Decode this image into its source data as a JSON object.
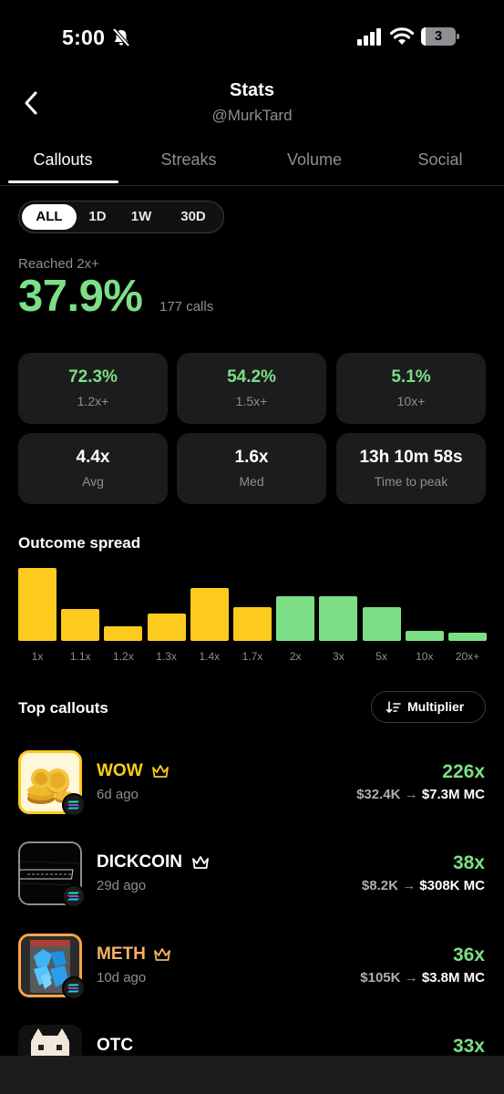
{
  "status_bar": {
    "time": "5:00",
    "battery": "3"
  },
  "header": {
    "title": "Stats",
    "subtitle": "@MurkTard"
  },
  "tabs": [
    {
      "label": "Callouts",
      "active": true
    },
    {
      "label": "Streaks",
      "active": false
    },
    {
      "label": "Volume",
      "active": false
    },
    {
      "label": "Social",
      "active": false
    }
  ],
  "range_filter": {
    "options": [
      "ALL",
      "1D",
      "1W",
      "30D"
    ],
    "selected": "ALL"
  },
  "reached": {
    "label": "Reached 2x+",
    "value": "37.9%",
    "calls": "177 calls"
  },
  "stat_cards": [
    {
      "value": "72.3%",
      "label": "1.2x+",
      "highlight": true
    },
    {
      "value": "54.2%",
      "label": "1.5x+",
      "highlight": true
    },
    {
      "value": "5.1%",
      "label": "10x+",
      "highlight": true
    },
    {
      "value": "4.4x",
      "label": "Avg",
      "highlight": false
    },
    {
      "value": "1.6x",
      "label": "Med",
      "highlight": false
    },
    {
      "value": "13h 10m 58s",
      "label": "Time to peak",
      "highlight": false
    }
  ],
  "outcome_title": "Outcome spread",
  "chart_data": {
    "type": "bar",
    "categories": [
      "1x",
      "1.1x",
      "1.2x",
      "1.3x",
      "1.4x",
      "1.7x",
      "2x",
      "3x",
      "5x",
      "10x",
      "20x+"
    ],
    "values": [
      80,
      35,
      16,
      30,
      58,
      37,
      49,
      49,
      37,
      11,
      9
    ],
    "colors": [
      "#fccb1e",
      "#fccb1e",
      "#fccb1e",
      "#fccb1e",
      "#fccb1e",
      "#fccb1e",
      "#7cdf86",
      "#7cdf86",
      "#7cdf86",
      "#7cdf86",
      "#7cdf86"
    ],
    "title": "Outcome spread"
  },
  "top_callouts": {
    "title": "Top callouts",
    "sort_label": "Multiplier",
    "items": [
      {
        "name": "WOW",
        "age": "6d ago",
        "multiplier": "226x",
        "mc_from": "$32.4K",
        "mc_to": "$7.3M MC",
        "name_color": "#fccb1e",
        "border_color": "#fccb1e"
      },
      {
        "name": "DICKCOIN",
        "age": "29d ago",
        "multiplier": "38x",
        "mc_from": "$8.2K",
        "mc_to": "$308K MC",
        "name_color": "#ffffff",
        "border_color": "#8e8e93"
      },
      {
        "name": "METH",
        "age": "10d ago",
        "multiplier": "36x",
        "mc_from": "$105K",
        "mc_to": "$3.8M MC",
        "name_color": "#f7b267",
        "border_color": "#f7a44a"
      },
      {
        "name": "OTC",
        "age": "",
        "multiplier": "33x",
        "mc_from": "",
        "mc_to": "",
        "name_color": "#ffffff",
        "border_color": "#1c1c1e"
      }
    ]
  },
  "arrow_glyph": "→",
  "colors": {
    "green": "#7cdf86",
    "yellow": "#fccb1e",
    "muted": "#8e8e93",
    "card": "#1c1c1e"
  }
}
